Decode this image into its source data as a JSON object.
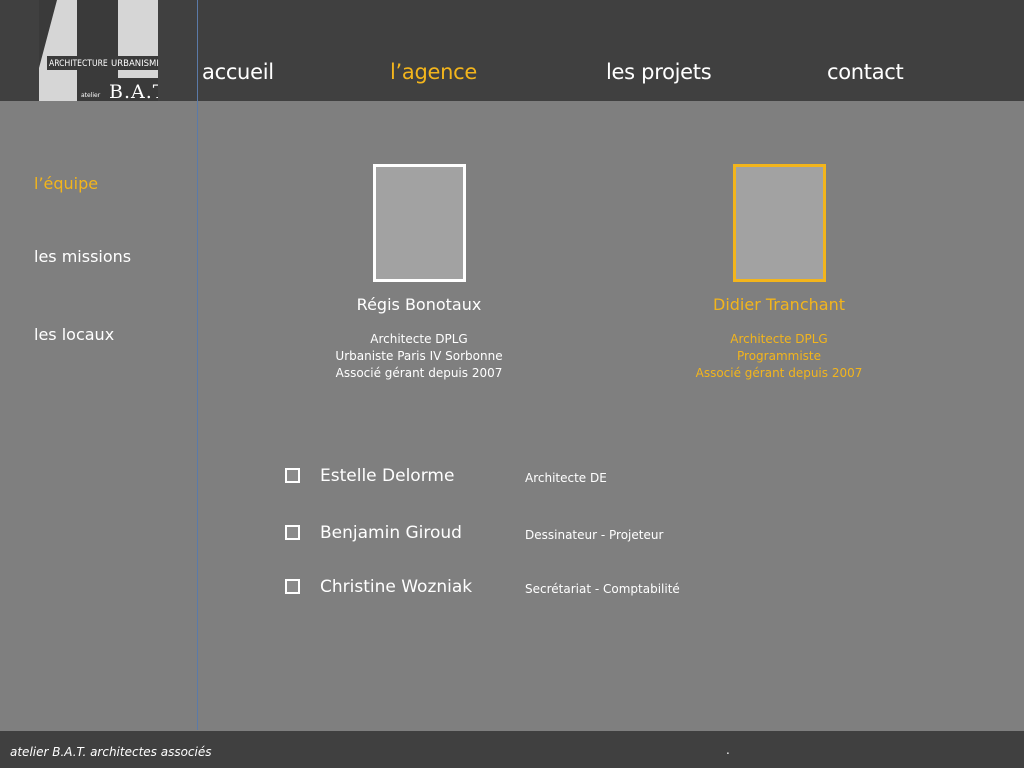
{
  "logo": {
    "line1": "ARCHITECTURE",
    "line2": "URBANISME",
    "small": "atelier",
    "main": "B.A.T."
  },
  "nav": {
    "items": [
      {
        "label": "accueil"
      },
      {
        "label": "l’agence"
      },
      {
        "label": "les projets"
      },
      {
        "label": "contact"
      }
    ]
  },
  "sidebar": {
    "items": [
      {
        "label": "l’équipe"
      },
      {
        "label": "les missions"
      },
      {
        "label": "les locaux"
      }
    ]
  },
  "partners": [
    {
      "name": "Régis Bonotaux",
      "details": [
        "Architecte DPLG",
        "Urbaniste Paris IV Sorbonne",
        "Associé gérant depuis 2007"
      ]
    },
    {
      "name": "Didier Tranchant",
      "details": [
        "Architecte DPLG",
        "Programmiste",
        "Associé gérant depuis 2007"
      ]
    }
  ],
  "staff": [
    {
      "name": "Estelle Delorme",
      "role": "Architecte DE"
    },
    {
      "name": "Benjamin Giroud",
      "role": "Dessinateur - Projeteur"
    },
    {
      "name": "Christine Wozniak",
      "role": "Secrétariat - Comptabilité"
    }
  ],
  "footer": {
    "text": "atelier B.A.T. architectes associés",
    "dot": "."
  },
  "colors": {
    "accent": "#f3b51c",
    "background": "#7f7f7f",
    "header": "#404040"
  }
}
